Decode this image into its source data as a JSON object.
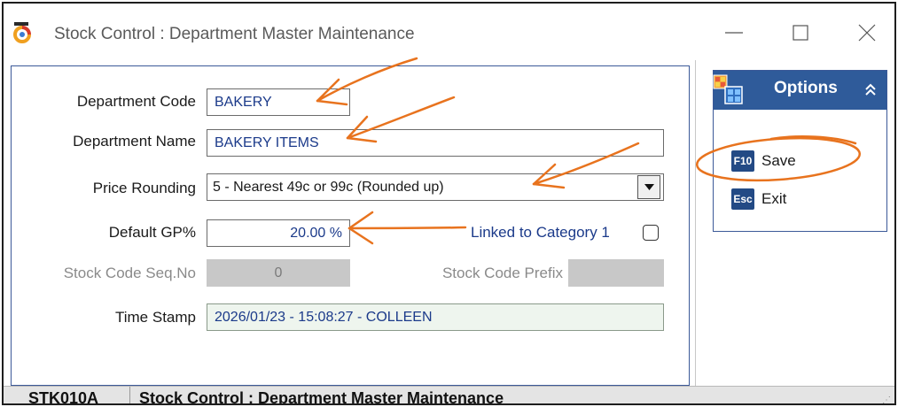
{
  "window": {
    "title": "Stock Control : Department Master Maintenance"
  },
  "form": {
    "department_code": {
      "label": "Department Code",
      "value": "BAKERY"
    },
    "department_name": {
      "label": "Department Name",
      "value": "BAKERY ITEMS"
    },
    "price_rounding": {
      "label": "Price Rounding",
      "value": "5 - Nearest 49c or 99c (Rounded up)"
    },
    "default_gp": {
      "label": "Default GP%",
      "value": "20.00 %"
    },
    "linked_category": {
      "label": "Linked to Category 1",
      "checked": false
    },
    "stock_code_seq": {
      "label": "Stock Code Seq.No",
      "value": "0"
    },
    "stock_code_prefix": {
      "label": "Stock Code Prefix",
      "value": ""
    },
    "time_stamp": {
      "label": "Time Stamp",
      "value": "2026/01/23 - 15:08:27 - COLLEEN"
    }
  },
  "options": {
    "title": "Options",
    "items": [
      {
        "key": "F10",
        "label": "Save"
      },
      {
        "key": "Esc",
        "label": "Exit"
      }
    ]
  },
  "status": {
    "code": "STK010A",
    "title": "Stock Control : Department Master Maintenance"
  },
  "colors": {
    "accent": "#2f5b9a",
    "field_text": "#1b3a8a",
    "annotation": "#e8731e"
  },
  "icons": {
    "app": "app-logo-icon",
    "minimize": "minimize-icon",
    "maximize": "maximize-icon",
    "close": "close-icon",
    "dropdown": "chevron-down-icon",
    "options": "options-grid-icon",
    "collapse": "double-chevron-up-icon"
  }
}
